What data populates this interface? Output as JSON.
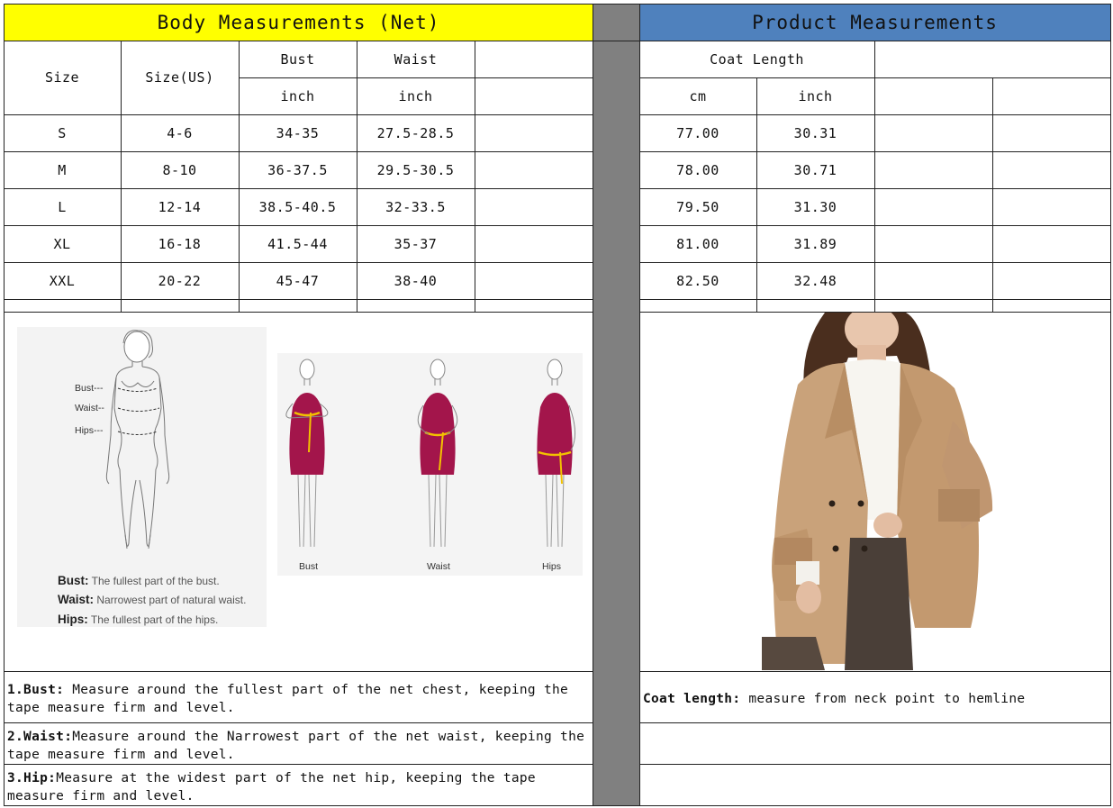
{
  "body_section": {
    "title": "Body Measurements (Net)",
    "columns": {
      "size": "Size",
      "size_us": "Size(US)",
      "bust": "Bust",
      "waist": "Waist",
      "bust_unit": "inch",
      "waist_unit": "inch"
    },
    "rows": [
      {
        "size": "S",
        "size_us": "4-6",
        "bust": "34-35",
        "waist": "27.5-28.5"
      },
      {
        "size": "M",
        "size_us": "8-10",
        "bust": "36-37.5",
        "waist": "29.5-30.5"
      },
      {
        "size": "L",
        "size_us": "12-14",
        "bust": "38.5-40.5",
        "waist": "32-33.5"
      },
      {
        "size": "XL",
        "size_us": "16-18",
        "bust": "41.5-44",
        "waist": "35-37"
      },
      {
        "size": "XXL",
        "size_us": "20-22",
        "bust": "45-47",
        "waist": "38-40"
      }
    ],
    "figure": {
      "labels": {
        "bust": "Bust---",
        "waist": "Waist--",
        "hips": "Hips---"
      },
      "definitions": [
        {
          "term": "Bust:",
          "text": "The fullest part of the bust."
        },
        {
          "term": "Waist:",
          "text": "Narrowest part of natural waist."
        },
        {
          "term": "Hips:",
          "text": "The fullest part of the hips."
        }
      ],
      "captions": [
        "Bust",
        "Waist",
        "Hips"
      ],
      "dress_color": "#a3154b",
      "tape_color": "#f2c200"
    },
    "notes": [
      {
        "term": "1.Bust:",
        "text": " Measure around the fullest part of the net chest, keeping the tape  measure firm and level."
      },
      {
        "term": "2.Waist:",
        "text": "Measure around the Narrowest part of the net waist, keeping the tape  measure firm and level."
      },
      {
        "term": "3.Hip:",
        "text": "Measure at the widest part of the net hip, keeping the tape measure firm and level."
      }
    ]
  },
  "product_section": {
    "title": "Product Measurements",
    "columns": {
      "coat_length": "Coat Length",
      "cm": "cm",
      "inch": "inch"
    },
    "rows": [
      {
        "cm": "77.00",
        "inch": "30.31"
      },
      {
        "cm": "78.00",
        "inch": "30.71"
      },
      {
        "cm": "79.50",
        "inch": "31.30"
      },
      {
        "cm": "81.00",
        "inch": "31.89"
      },
      {
        "cm": "82.50",
        "inch": "32.48"
      }
    ],
    "photo": {
      "coat_color": "#c9a27a",
      "sweater_color": "#f7f5f0",
      "pants_color": "#4a3f38",
      "hair_color": "#4a2e1e"
    },
    "note": {
      "term": "Coat length:",
      "text": " measure from neck point to hemline"
    }
  },
  "colors": {
    "body_header": "#ffff00",
    "product_header": "#4f81bd",
    "separator": "#808080"
  }
}
